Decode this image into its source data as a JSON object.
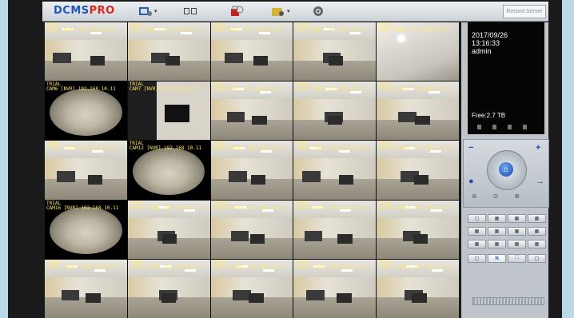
{
  "toolbar": {
    "logo_main": "DCMS",
    "logo_accent": "PRO",
    "record_server": "Record Server",
    "buttons": [
      {
        "icon": "camera-settings-icon",
        "has_dropdown": true
      },
      {
        "icon": "display-layout-icon",
        "has_dropdown": false
      },
      {
        "icon": "alarm-lock-icon",
        "has_dropdown": false
      },
      {
        "icon": "folder-playback-icon",
        "has_dropdown": true
      },
      {
        "icon": "settings-gear-icon",
        "has_dropdown": false
      }
    ]
  },
  "cameras": [
    {
      "label1": "TRIAL",
      "label2": "CAM1 [NVR] 192.168.10.11",
      "type": "office"
    },
    {
      "label1": "TRIAL",
      "label2": "CAM2 [NVR] 192.168.10.11",
      "type": "office"
    },
    {
      "label1": "TRIAL",
      "label2": "CAM3 [NVR] 192.168.10.11",
      "type": "office"
    },
    {
      "label1": "TRIAL",
      "label2": "CAM4 [NVR] 192.168.10.11",
      "type": "office"
    },
    {
      "label1": "TRIAL",
      "label2": "CAM5 [NVR] 192.168.10.11",
      "type": "ceiling"
    },
    {
      "label1": "TRIAL",
      "label2": "CAM6 [NVR] 192.168.10.11",
      "type": "fisheye"
    },
    {
      "label1": "TRIAL",
      "label2": "CAM7 [NVR] 192.168.10.11",
      "type": "dark"
    },
    {
      "label1": "TRIAL",
      "label2": "CAM8 [NVR] 192.168.10.11",
      "type": "office"
    },
    {
      "label1": "TRIAL",
      "label2": "CAM9 [NVR] 192.168.10.11",
      "type": "office"
    },
    {
      "label1": "TRIAL",
      "label2": "CAM10 [NVR] 192.168.10.11",
      "type": "office"
    },
    {
      "label1": "TRIAL",
      "label2": "CAM11 [NVR] 192.168.10.11",
      "type": "office"
    },
    {
      "label1": "TRIAL",
      "label2": "CAM12 [NVR] 192.168.10.11",
      "type": "fisheye"
    },
    {
      "label1": "TRIAL",
      "label2": "CAM13 [NVR] 192.168.10.11",
      "type": "office"
    },
    {
      "label1": "TRIAL",
      "label2": "CAM14 [NVR] 192.168.10.11",
      "type": "office"
    },
    {
      "label1": "TRIAL",
      "label2": "CAM15 [NVR] 192.168.10.11",
      "type": "office"
    },
    {
      "label1": "TRIAL",
      "label2": "CAM16 [NVR] 192.168.10.11",
      "type": "fisheye"
    },
    {
      "label1": "TRIAL",
      "label2": "CAM17 [NVR] 192.168.10.11",
      "type": "office"
    },
    {
      "label1": "TRIAL",
      "label2": "CAM18 [NVR] 192.168.10.11",
      "type": "office"
    },
    {
      "label1": "TRIAL",
      "label2": "CAM19 [NVR] 192.168.10.11",
      "type": "office"
    },
    {
      "label1": "TRIAL",
      "label2": "CAM20 [NVR] 192.168.10.11",
      "type": "office"
    },
    {
      "label1": "TRIAL",
      "label2": "CAM21 [NVR] 192.168.10.11",
      "type": "office"
    },
    {
      "label1": "TRIAL",
      "label2": "CAM22 [NVR] 192.168.10.11",
      "type": "office"
    },
    {
      "label1": "TRIAL",
      "label2": "CAM23 [NVR] 192.168.10.11",
      "type": "office"
    },
    {
      "label1": "TRIAL",
      "label2": "CAM24 [NVR] 192.168.10.11",
      "type": "office"
    },
    {
      "label1": "TRIAL",
      "label2": "CAM25 [NVR] 192.168.10.11",
      "type": "office"
    }
  ],
  "info": {
    "date": "2017/09/26",
    "time": "13:16:33",
    "user": "admin",
    "free": "Free:2.7 TB"
  },
  "ptz": {
    "minus_left": "−",
    "plus_right": "+",
    "home": "⌂"
  },
  "layout_buttons": {
    "row1": [
      "▢",
      "▦",
      "▦",
      "▦"
    ],
    "row2": [
      "▦",
      "▦",
      "▦",
      "▦"
    ],
    "row3": [
      "▦",
      "▦",
      "▦",
      "▦"
    ],
    "row4": [
      "▢",
      "N",
      "⛶",
      "▢"
    ]
  },
  "colors": {
    "logo_blue": "#1f57b8",
    "logo_red": "#d9261c",
    "overlay_text": "#ffe866",
    "panel": "#bfc5ca"
  }
}
